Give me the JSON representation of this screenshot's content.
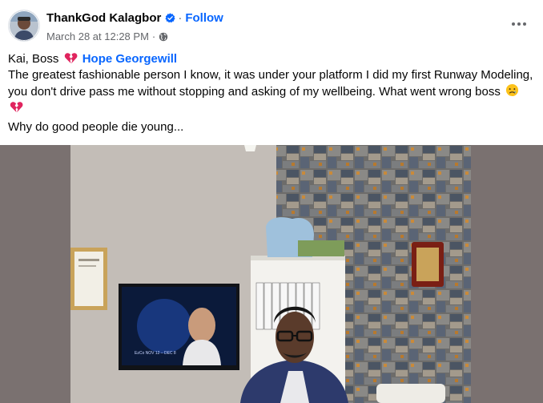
{
  "post": {
    "author": "ThankGod Kalagbor",
    "separator": "·",
    "follow_label": "Follow",
    "timestamp": "March 28 at 12:28 PM",
    "timestamp_separator": "·",
    "audience_icon": "globe-icon",
    "more_icon": "more-horizontal-icon",
    "verified_icon": "verified-badge-icon",
    "accent_color": "#0866ff",
    "text": {
      "greeting": "Kai, Boss",
      "mention": "Hope Georgewill",
      "body_line": "The greatest fashionable person I know, it was under your platform I did my first Runway Modeling, you don't drive pass me without stopping and asking of my wellbeing. What went wrong boss",
      "closing": "Why do good people die young..."
    },
    "media": {
      "tv_caption": "EzCo NOV 12 – DEC 8"
    }
  }
}
